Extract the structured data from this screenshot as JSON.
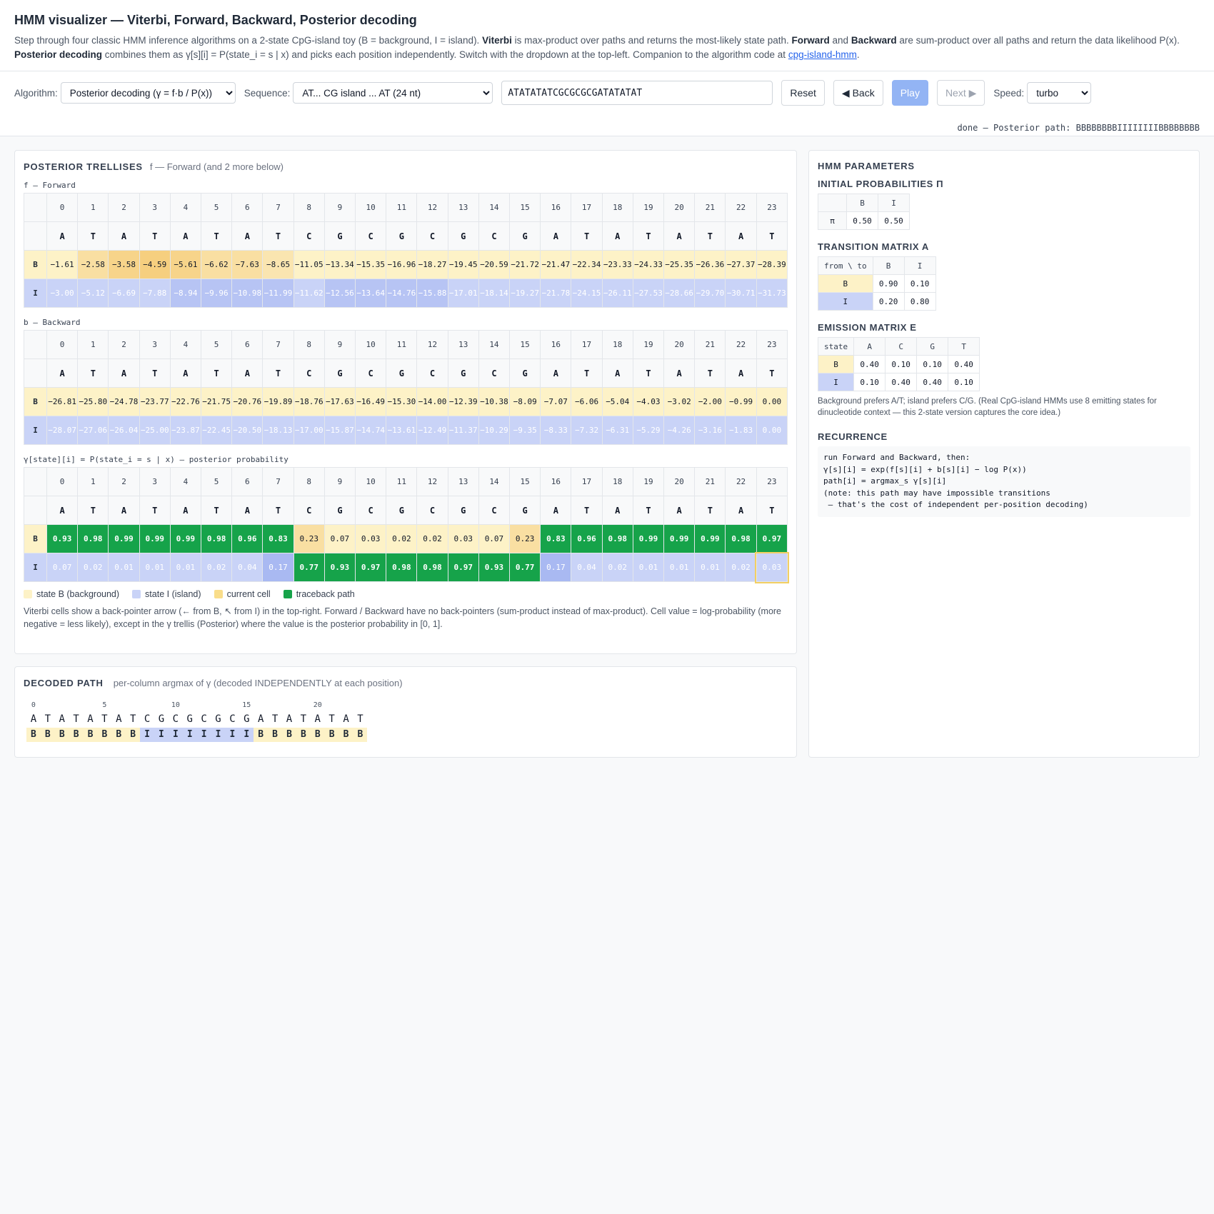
{
  "header": {
    "title": "HMM visualizer — Viterbi, Forward, Backward, Posterior decoding",
    "desc_1": "Step through four classic HMM inference algorithms on a 2-state CpG-island toy (B = background, I = island). ",
    "desc_viterbi": "Viterbi",
    "desc_2": " is max-product over paths and returns the most-likely state path. ",
    "desc_forward": "Forward",
    "desc_3": " and ",
    "desc_backward": "Backward",
    "desc_4": " are sum-product over all paths and return the data likelihood P(x). ",
    "desc_posterior": "Posterior decoding",
    "desc_5": " combines them as γ[s][i] = P(state_i = s | x) and picks each position independently. Switch with the dropdown at the top-left. Companion to the algorithm code at ",
    "link": "cpg-island-hmm",
    "desc_6": "."
  },
  "controls": {
    "algorithm_label": "Algorithm:",
    "algorithm_value": "Posterior decoding (γ = f·b / P(x))",
    "sequence_label": "Sequence:",
    "sequence_value": "AT... CG island ... AT (24 nt)",
    "sequence_input": "ATATATATCGCGCGCGATATATAT",
    "reset": "Reset",
    "back": "◀ Back",
    "play": "Play",
    "next": "Next ▶",
    "speed_label": "Speed:",
    "speed_value": "turbo",
    "status": "done — Posterior path: BBBBBBBBIIIIIIIIBBBBBBBB"
  },
  "trellis_panel": {
    "title": "POSTERIOR TRELLISES",
    "subtitle": "f — Forward (and 2 more below)",
    "observations": [
      "A",
      "T",
      "A",
      "T",
      "A",
      "T",
      "A",
      "T",
      "C",
      "G",
      "C",
      "G",
      "C",
      "G",
      "C",
      "G",
      "A",
      "T",
      "A",
      "T",
      "A",
      "T",
      "A",
      "T"
    ],
    "forward": {
      "label": "f — Forward",
      "B": [
        "−1.61",
        "−2.58",
        "−3.58",
        "−4.59",
        "−5.61",
        "−6.62",
        "−7.63",
        "−8.65",
        "−11.05",
        "−13.34",
        "−15.35",
        "−16.96",
        "−18.27",
        "−19.45",
        "−20.59",
        "−21.72",
        "−21.47",
        "−22.34",
        "−23.33",
        "−24.33",
        "−25.35",
        "−26.36",
        "−27.37",
        "−28.39"
      ],
      "I": [
        "−3.00",
        "−5.12",
        "−6.69",
        "−7.88",
        "−8.94",
        "−9.96",
        "−10.98",
        "−11.99",
        "−11.62",
        "−12.56",
        "−13.64",
        "−14.76",
        "−15.88",
        "−17.01",
        "−18.14",
        "−19.27",
        "−21.78",
        "−24.15",
        "−26.11",
        "−27.53",
        "−28.66",
        "−29.70",
        "−30.71",
        "−31.73"
      ]
    },
    "backward": {
      "label": "b — Backward",
      "B": [
        "−26.81",
        "−25.80",
        "−24.78",
        "−23.77",
        "−22.76",
        "−21.75",
        "−20.76",
        "−19.89",
        "−18.76",
        "−17.63",
        "−16.49",
        "−15.30",
        "−14.00",
        "−12.39",
        "−10.38",
        "−8.09",
        "−7.07",
        "−6.06",
        "−5.04",
        "−4.03",
        "−3.02",
        "−2.00",
        "−0.99",
        "0.00"
      ],
      "I": [
        "−28.07",
        "−27.06",
        "−26.04",
        "−25.00",
        "−23.87",
        "−22.45",
        "−20.50",
        "−18.13",
        "−17.00",
        "−15.87",
        "−14.74",
        "−13.61",
        "−12.49",
        "−11.37",
        "−10.29",
        "−9.35",
        "−8.33",
        "−7.32",
        "−6.31",
        "−5.29",
        "−4.26",
        "−3.16",
        "−1.83",
        "0.00"
      ]
    },
    "posterior": {
      "label": "γ[state][i] = P(state_i = s | x) — posterior probability",
      "B": [
        "0.93",
        "0.98",
        "0.99",
        "0.99",
        "0.99",
        "0.98",
        "0.96",
        "0.83",
        "0.23",
        "0.07",
        "0.03",
        "0.02",
        "0.02",
        "0.03",
        "0.07",
        "0.23",
        "0.83",
        "0.96",
        "0.98",
        "0.99",
        "0.99",
        "0.99",
        "0.98",
        "0.97"
      ],
      "I": [
        "0.07",
        "0.02",
        "0.01",
        "0.01",
        "0.01",
        "0.02",
        "0.04",
        "0.17",
        "0.77",
        "0.93",
        "0.97",
        "0.98",
        "0.98",
        "0.97",
        "0.93",
        "0.77",
        "0.17",
        "0.04",
        "0.02",
        "0.01",
        "0.01",
        "0.01",
        "0.02",
        "0.03"
      ]
    },
    "legend": {
      "state_b": "state B (background)",
      "state_i": "state I (island)",
      "current": "current cell",
      "traceback": "traceback path"
    },
    "note": "Viterbi cells show a back-pointer arrow (← from B, ↖ from I) in the top-right. Forward / Backward have no back-pointers (sum-product instead of max-product). Cell value = log-probability (more negative = less likely), except in the γ trellis (Posterior) where the value is the posterior probability in [0, 1]."
  },
  "params_panel": {
    "title": "HMM PARAMETERS",
    "initial_title": "INITIAL PROBABILITIES Π",
    "initial": {
      "hdr": [
        "",
        "B",
        "I"
      ],
      "row": [
        "π",
        "0.50",
        "0.50"
      ]
    },
    "transition_title": "TRANSITION MATRIX A",
    "transition": {
      "hdr": [
        "from \\ to",
        "B",
        "I"
      ],
      "rows": [
        [
          "B",
          "0.90",
          "0.10"
        ],
        [
          "I",
          "0.20",
          "0.80"
        ]
      ]
    },
    "emission_title": "EMISSION MATRIX E",
    "emission": {
      "hdr": [
        "state",
        "A",
        "C",
        "G",
        "T"
      ],
      "rows": [
        [
          "B",
          "0.40",
          "0.10",
          "0.10",
          "0.40"
        ],
        [
          "I",
          "0.10",
          "0.40",
          "0.40",
          "0.10"
        ]
      ]
    },
    "emission_note": "Background prefers A/T; island prefers C/G. (Real CpG-island HMMs use 8 emitting states for dinucleotide context — this 2-state version captures the core idea.)",
    "recurrence_title": "RECURRENCE",
    "recurrence_code": "run Forward and Backward, then:\nγ[s][i] = exp(f[s][i] + b[s][i] − log P(x))\npath[i] = argmax_s γ[s][i]\n(note: this path may have impossible transitions\n — that's the cost of independent per-position decoding)"
  },
  "decoded_panel": {
    "title": "DECODED PATH",
    "subtitle": "per-column argmax of γ (decoded INDEPENDENTLY at each position)",
    "ticks": [
      "0",
      "5",
      "10",
      "15",
      "20"
    ],
    "sequence": [
      "A",
      "T",
      "A",
      "T",
      "A",
      "T",
      "A",
      "T",
      "C",
      "G",
      "C",
      "G",
      "C",
      "G",
      "C",
      "G",
      "A",
      "T",
      "A",
      "T",
      "A",
      "T",
      "A",
      "T"
    ],
    "path": [
      "B",
      "B",
      "B",
      "B",
      "B",
      "B",
      "B",
      "B",
      "I",
      "I",
      "I",
      "I",
      "I",
      "I",
      "I",
      "I",
      "B",
      "B",
      "B",
      "B",
      "B",
      "B",
      "B",
      "B"
    ]
  },
  "colors": {
    "state_b": "#fdf2c7",
    "state_i": "#c9d3f7",
    "current": "#f9dd8a",
    "traceback": "#16a34a"
  }
}
